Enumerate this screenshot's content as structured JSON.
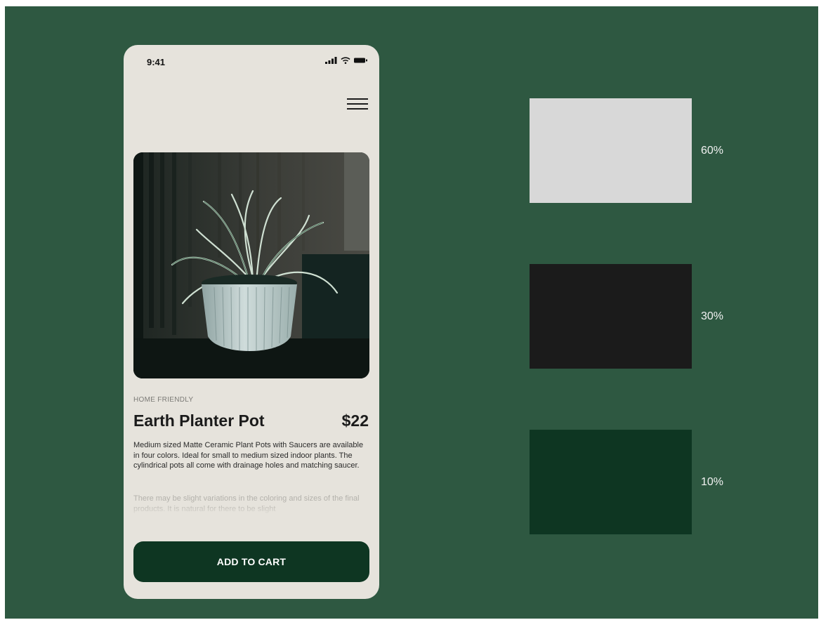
{
  "status_bar": {
    "time": "9:41"
  },
  "product": {
    "category": "HOME FRIENDLY",
    "name": "Earth Planter Pot",
    "price": "$22",
    "description": "Medium sized Matte Ceramic Plant Pots with Saucers are available in four colors. Ideal for small to medium sized indoor plants. The cylindrical pots all come with drainage holes and matching saucer.",
    "description_more": "There may be slight variations in the coloring and sizes of the final products. It is natural for there to be slight"
  },
  "cart_button": {
    "label": "ADD TO CART"
  },
  "palette": [
    {
      "label": "60%",
      "color": "#d8d8d8"
    },
    {
      "label": "30%",
      "color": "#1b1b1b"
    },
    {
      "label": "10%",
      "color": "#0e3622"
    }
  ],
  "colors": {
    "background": "#2e5841",
    "phone": "#e6e3dc",
    "accent": "#0e3622"
  }
}
